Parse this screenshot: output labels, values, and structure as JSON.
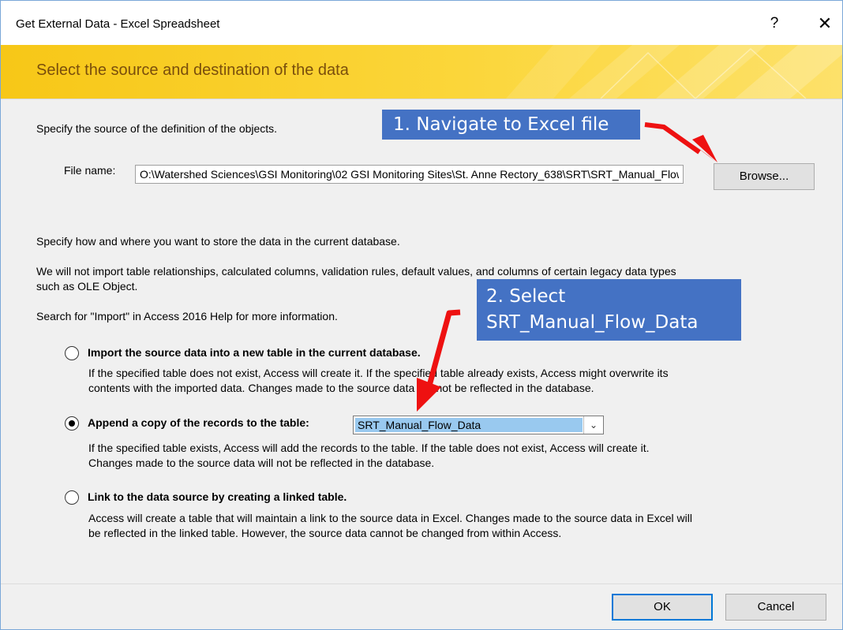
{
  "window": {
    "title": "Get External Data - Excel Spreadsheet",
    "help_label": "?",
    "close_label": "✕"
  },
  "banner": {
    "title": "Select the source and destination of the data"
  },
  "source": {
    "instruction": "Specify the source of the definition of the objects.",
    "file_label": "File name:",
    "file_value": "O:\\Watershed Sciences\\GSI Monitoring\\02 GSI Monitoring Sites\\St. Anne Rectory_638\\SRT\\SRT_Manual_Flow_Data.xlsx",
    "browse_label": "Browse..."
  },
  "info": {
    "line1": "Specify how and where you want to store the data in the current database.",
    "line2a": "We will not import table relationships, calculated columns, validation rules, default values, and columns of certain legacy data types",
    "line2b": "such as OLE Object.",
    "line3": "Search for \"Import\" in Access 2016 Help for more information."
  },
  "options": [
    {
      "label": "Import the source data into a new table in the current database.",
      "desc1": "If the specified table does not exist, Access will create it. If the specified table already exists, Access might overwrite its",
      "desc2": "contents with the imported data. Changes made to the source data will not be reflected in the database.",
      "selected": false
    },
    {
      "label": "Append a copy of the records to the table:",
      "desc1": "If the specified table exists, Access will add the records to the table. If the table does not exist, Access will create it.",
      "desc2": "Changes made to the source data will not be reflected in the database.",
      "selected": true
    },
    {
      "label": "Link to the data source by creating a linked table.",
      "desc1": "Access will create a table that will maintain a link to the source data in Excel. Changes made to the source data in Excel will",
      "desc2": "be reflected in the linked table. However, the source data cannot be changed from within Access.",
      "selected": false
    }
  ],
  "table_select": {
    "value": "SRT_Manual_Flow_Data"
  },
  "callouts": {
    "c1": "1. Navigate to Excel file",
    "c2_line1": "2. Select",
    "c2_line2": "SRT_Manual_Flow_Data"
  },
  "footer": {
    "ok_label": "OK",
    "cancel_label": "Cancel"
  },
  "colors": {
    "banner": "#f7c717",
    "banner_text": "#7a4e0c",
    "callout": "#4472c4",
    "annotation_arrow": "#ee1111",
    "selection": "#99c9ef"
  }
}
